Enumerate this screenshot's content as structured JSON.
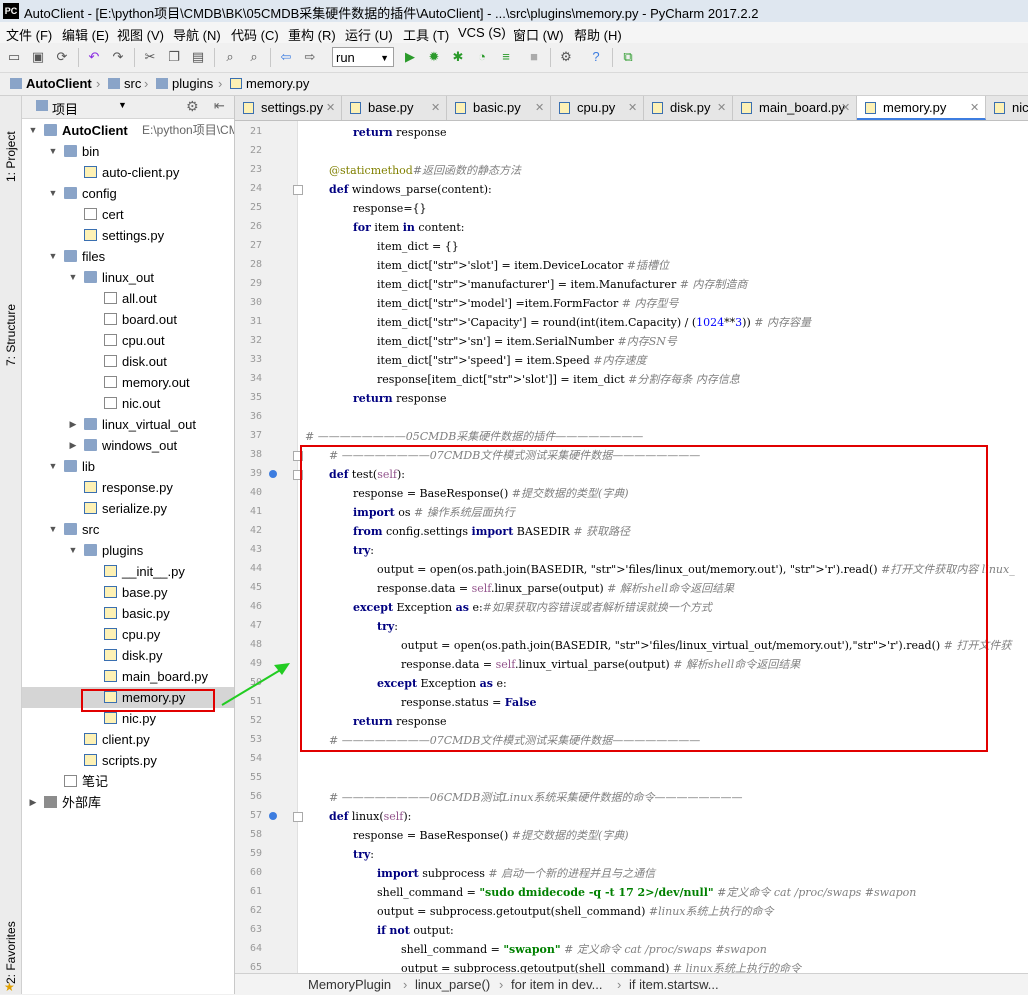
{
  "window": {
    "title": "AutoClient - [E:\\python项目\\CMDB\\BK\\05CMDB采集硬件数据的插件\\AutoClient] - ...\\src\\plugins\\memory.py - PyCharm 2017.2.2"
  },
  "menu": [
    "文件 (F)",
    "编辑 (E)",
    "视图 (V)",
    "导航 (N)",
    "代码 (C)",
    "重构 (R)",
    "运行 (U)",
    "工具 (T)",
    "VCS (S)",
    "窗口 (W)",
    "帮助 (H)"
  ],
  "toolbar": {
    "run_config": "run"
  },
  "breadcrumb": [
    "AutoClient",
    "src",
    "plugins",
    "memory.py"
  ],
  "left_strip": {
    "project": "1: Project",
    "structure": "7: Structure",
    "favorites": "2: Favorites"
  },
  "project_panel": {
    "header": "项目",
    "tree": [
      {
        "label": "AutoClient",
        "extra": "E:\\python项目\\CMDB\\BK",
        "kind": "folder",
        "depth": 0,
        "open": true
      },
      {
        "label": "bin",
        "kind": "folder",
        "depth": 1,
        "open": true
      },
      {
        "label": "auto-client.py",
        "kind": "py",
        "depth": 2
      },
      {
        "label": "config",
        "kind": "folder",
        "depth": 1,
        "open": true
      },
      {
        "label": "cert",
        "kind": "txt",
        "depth": 2
      },
      {
        "label": "settings.py",
        "kind": "py",
        "depth": 2
      },
      {
        "label": "files",
        "kind": "folder",
        "depth": 1,
        "open": true
      },
      {
        "label": "linux_out",
        "kind": "folder",
        "depth": 2,
        "open": true
      },
      {
        "label": "all.out",
        "kind": "txt",
        "depth": 3
      },
      {
        "label": "board.out",
        "kind": "txt",
        "depth": 3
      },
      {
        "label": "cpu.out",
        "kind": "txt",
        "depth": 3
      },
      {
        "label": "disk.out",
        "kind": "txt",
        "depth": 3
      },
      {
        "label": "memory.out",
        "kind": "txt",
        "depth": 3
      },
      {
        "label": "nic.out",
        "kind": "txt",
        "depth": 3
      },
      {
        "label": "linux_virtual_out",
        "kind": "folder",
        "depth": 2,
        "open": false
      },
      {
        "label": "windows_out",
        "kind": "folder",
        "depth": 2,
        "open": false
      },
      {
        "label": "lib",
        "kind": "folder",
        "depth": 1,
        "open": true
      },
      {
        "label": "response.py",
        "kind": "py",
        "depth": 2
      },
      {
        "label": "serialize.py",
        "kind": "py",
        "depth": 2
      },
      {
        "label": "src",
        "kind": "folder",
        "depth": 1,
        "open": true
      },
      {
        "label": "plugins",
        "kind": "folder",
        "depth": 2,
        "open": true
      },
      {
        "label": "__init__.py",
        "kind": "py",
        "depth": 3
      },
      {
        "label": "base.py",
        "kind": "py",
        "depth": 3
      },
      {
        "label": "basic.py",
        "kind": "py",
        "depth": 3
      },
      {
        "label": "cpu.py",
        "kind": "py",
        "depth": 3
      },
      {
        "label": "disk.py",
        "kind": "py",
        "depth": 3
      },
      {
        "label": "main_board.py",
        "kind": "py",
        "depth": 3
      },
      {
        "label": "memory.py",
        "kind": "py",
        "depth": 3,
        "selected": true
      },
      {
        "label": "nic.py",
        "kind": "py",
        "depth": 3
      },
      {
        "label": "client.py",
        "kind": "py",
        "depth": 2
      },
      {
        "label": "scripts.py",
        "kind": "py",
        "depth": 2
      },
      {
        "label": "笔记",
        "kind": "txt",
        "depth": 1
      },
      {
        "label": "外部库",
        "kind": "lib",
        "depth": 0,
        "open": false
      }
    ]
  },
  "tabs": [
    {
      "label": "settings.py",
      "active": false
    },
    {
      "label": "base.py",
      "active": false
    },
    {
      "label": "basic.py",
      "active": false
    },
    {
      "label": "cpu.py",
      "active": false
    },
    {
      "label": "disk.py",
      "active": false
    },
    {
      "label": "main_board.py",
      "active": false
    },
    {
      "label": "memory.py",
      "active": true
    },
    {
      "label": "nic.py",
      "active": false
    }
  ],
  "editor": {
    "lines": [
      {
        "n": "21",
        "indent": 2,
        "t": "return response"
      },
      {
        "n": "22",
        "indent": 0,
        "t": ""
      },
      {
        "n": "23",
        "indent": 1,
        "t": "@staticmethod#返回函数的静态方法"
      },
      {
        "n": "24",
        "indent": 1,
        "t": "def windows_parse(content):"
      },
      {
        "n": "25",
        "indent": 2,
        "t": "response={}"
      },
      {
        "n": "26",
        "indent": 2,
        "t": "for item in content:"
      },
      {
        "n": "27",
        "indent": 3,
        "t": "item_dict = {}"
      },
      {
        "n": "28",
        "indent": 3,
        "t": "item_dict['slot'] = item.DeviceLocator                              #插槽位"
      },
      {
        "n": "29",
        "indent": 3,
        "t": "item_dict['manufacturer'] = item.Manufacturer                     # 内存制造商"
      },
      {
        "n": "30",
        "indent": 3,
        "t": "item_dict['model'] =item.FormFactor                                # 内存型号"
      },
      {
        "n": "31",
        "indent": 3,
        "t": "item_dict['Capacity'] = round(int(item.Capacity) / (1024**3))      # 内存容量"
      },
      {
        "n": "32",
        "indent": 3,
        "t": "item_dict['sn'] = item.SerialNumber                                #内存SN号"
      },
      {
        "n": "33",
        "indent": 3,
        "t": "item_dict['speed'] = item.Speed                                    #内存速度"
      },
      {
        "n": "34",
        "indent": 3,
        "t": "response[item_dict['slot']] = item_dict                            #分割存每条  内存信息"
      },
      {
        "n": "35",
        "indent": 2,
        "t": "return response"
      },
      {
        "n": "36",
        "indent": 0,
        "t": ""
      },
      {
        "n": "37",
        "indent": 0,
        "t": "# ————————05CMDB采集硬件数据的插件————————"
      },
      {
        "n": "38",
        "indent": 1,
        "t": "# ————————07CMDB文件模式测试采集硬件数据————————"
      },
      {
        "n": "39",
        "indent": 1,
        "t": "def test(self):"
      },
      {
        "n": "40",
        "indent": 2,
        "t": "response = BaseResponse() #提交数据的类型(字典)"
      },
      {
        "n": "41",
        "indent": 2,
        "t": "import os  # 操作系统层面执行"
      },
      {
        "n": "42",
        "indent": 2,
        "t": "from config.settings import BASEDIR  # 获取路径"
      },
      {
        "n": "43",
        "indent": 2,
        "t": "try:"
      },
      {
        "n": "44",
        "indent": 3,
        "t": "output = open(os.path.join(BASEDIR, 'files/linux_out/memory.out'), 'r').read()  #打开文件获取内容 linux_"
      },
      {
        "n": "45",
        "indent": 3,
        "t": "response.data = self.linux_parse(output)  # 解析shell命令返回结果"
      },
      {
        "n": "46",
        "indent": 2,
        "t": "except Exception as e:#如果获取内容错误或者解析错误就换一个方式"
      },
      {
        "n": "47",
        "indent": 3,
        "t": "try:"
      },
      {
        "n": "48",
        "indent": 4,
        "t": "output = open(os.path.join(BASEDIR, 'files/linux_virtual_out/memory.out'),'r').read()  # 打开文件获"
      },
      {
        "n": "49",
        "indent": 4,
        "t": "response.data = self.linux_virtual_parse(output)  # 解析shell命令返回结果"
      },
      {
        "n": "50",
        "indent": 3,
        "t": "except Exception as e:"
      },
      {
        "n": "51",
        "indent": 4,
        "t": "response.status = False"
      },
      {
        "n": "52",
        "indent": 2,
        "t": "return response"
      },
      {
        "n": "53",
        "indent": 1,
        "t": "# ————————07CMDB文件模式测试采集硬件数据————————"
      },
      {
        "n": "54",
        "indent": 0,
        "t": ""
      },
      {
        "n": "55",
        "indent": 0,
        "t": ""
      },
      {
        "n": "56",
        "indent": 1,
        "t": "# ————————06CMDB测试Linux系统采集硬件数据的命令————————"
      },
      {
        "n": "57",
        "indent": 1,
        "t": "def linux(self):"
      },
      {
        "n": "58",
        "indent": 2,
        "t": "response = BaseResponse() #提交数据的类型(字典)"
      },
      {
        "n": "59",
        "indent": 2,
        "t": "try:"
      },
      {
        "n": "60",
        "indent": 3,
        "t": "import subprocess  # 启动一个新的进程并且与之通信"
      },
      {
        "n": "61",
        "indent": 3,
        "t": "shell_command = \"sudo dmidecode  -q -t 17 2>/dev/null\" #定义命令 cat /proc/swaps   #swapon"
      },
      {
        "n": "62",
        "indent": 3,
        "t": "output = subprocess.getoutput(shell_command) #linux系统上执行的命令"
      },
      {
        "n": "63",
        "indent": 3,
        "t": "if not output:"
      },
      {
        "n": "64",
        "indent": 4,
        "t": "shell_command = \"swapon\"  # 定义命令  cat /proc/swaps   #swapon"
      },
      {
        "n": "65",
        "indent": 4,
        "t": "output = subprocess.getoutput(shell_command)  # linux系统上执行的命令"
      }
    ]
  },
  "statusbar": [
    "MemoryPlugin",
    "linux_parse()",
    "for item in dev...",
    "if item.startsw..."
  ]
}
